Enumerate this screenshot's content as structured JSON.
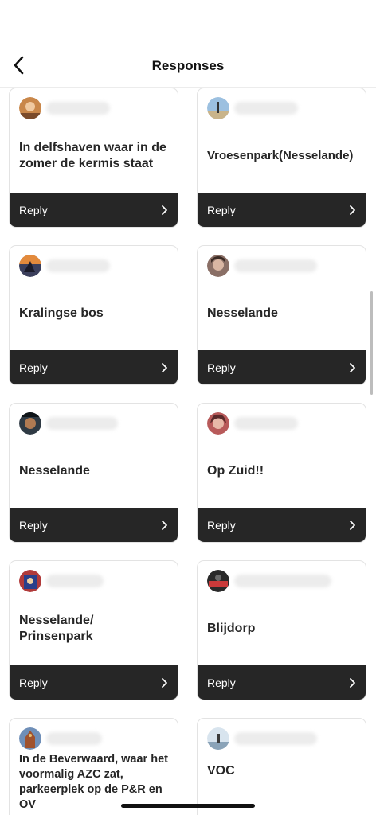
{
  "header": {
    "title": "Responses",
    "back_icon": "chevron-left-icon"
  },
  "reply_label": "Reply",
  "responses": [
    {
      "text": "In delfshaven waar in de zomer de kermis staat",
      "avatar_color": "#c9874a"
    },
    {
      "text": "Vroesenpark(Nesselande)",
      "avatar_color": "#7fa3c9"
    },
    {
      "text": "Kralingse bos",
      "avatar_color": "#3b3f5c"
    },
    {
      "text": "Nesselande",
      "avatar_color": "#8a6f66"
    },
    {
      "text": "Nesselande",
      "avatar_color": "#2f3a44"
    },
    {
      "text": "Op Zuid!!",
      "avatar_color": "#b85a5a"
    },
    {
      "text": "Nesselande/ Prinsenpark",
      "avatar_color": "#b03a3a"
    },
    {
      "text": "Blijdorp",
      "avatar_color": "#2a2a2a"
    },
    {
      "text": "In de Beverwaard, waar het voormalig AZC zat, parkeerplek op de P&R en OV",
      "avatar_color": "#a0522d"
    },
    {
      "text": "VOC",
      "avatar_color": "#9bb6cc"
    }
  ]
}
